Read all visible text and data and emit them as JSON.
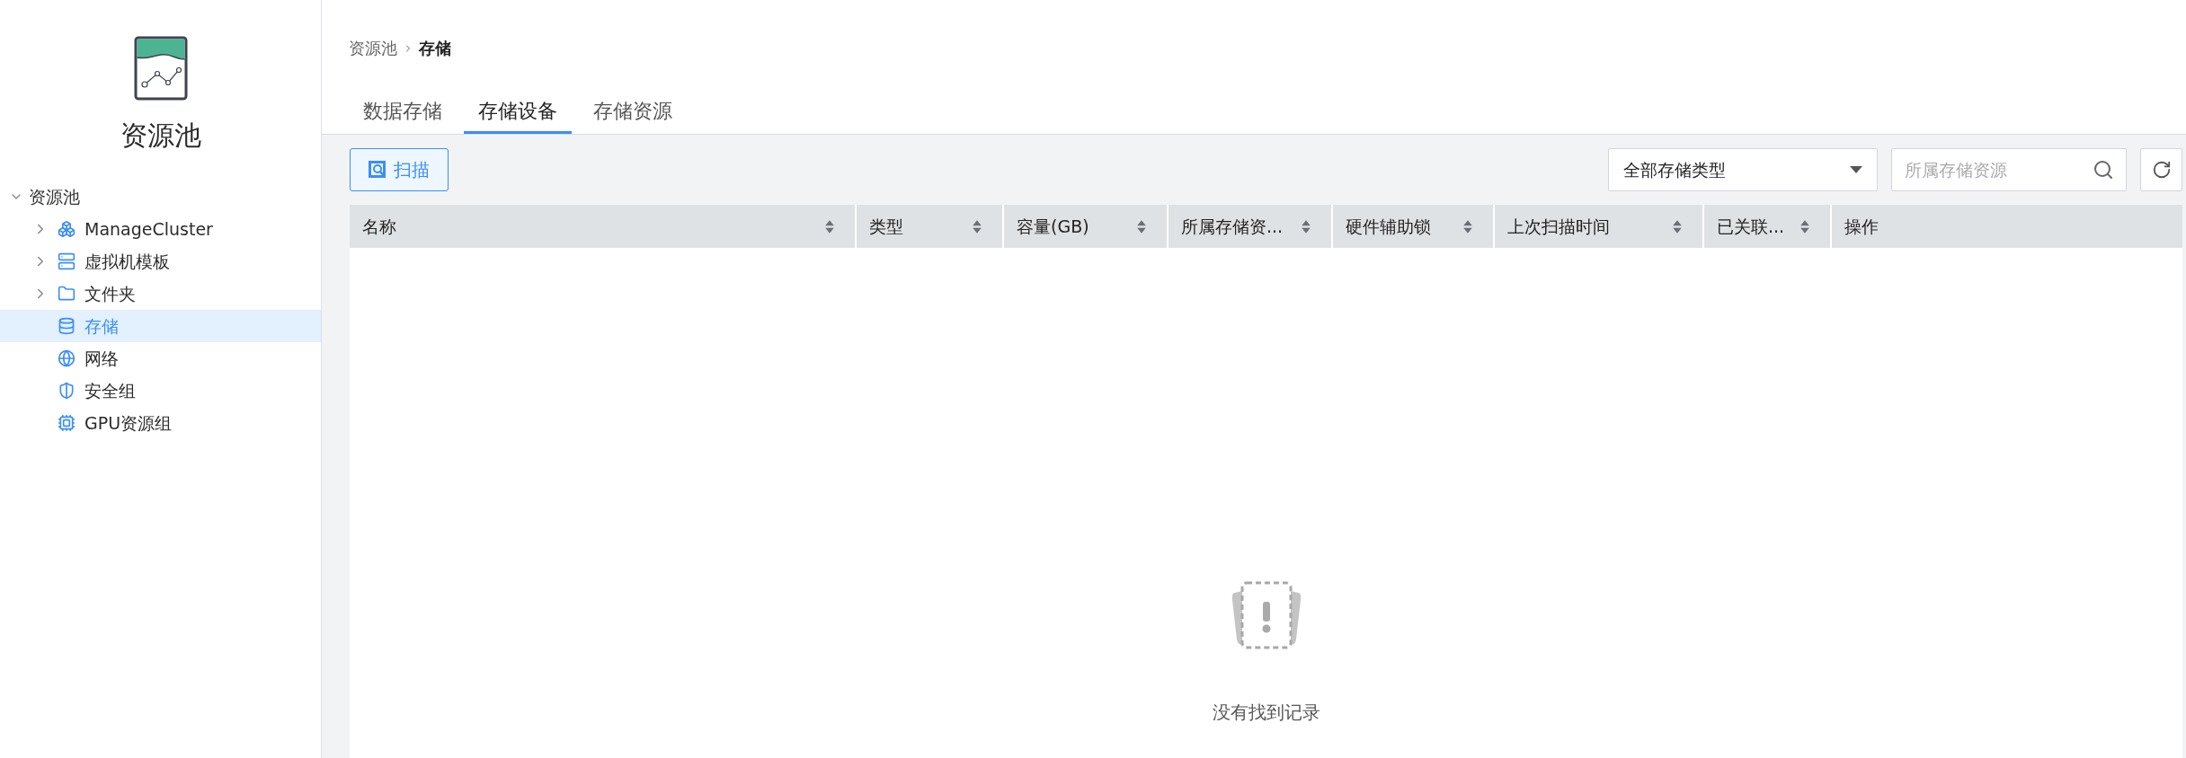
{
  "sidebar": {
    "title": "资源池",
    "tree": {
      "label": "资源池",
      "expanded": true,
      "children": [
        {
          "label": "ManageCluster",
          "kind": "cluster",
          "expandable": true,
          "selected": false
        },
        {
          "label": "虚拟机模板",
          "kind": "template",
          "expandable": true,
          "selected": false
        },
        {
          "label": "文件夹",
          "kind": "folder",
          "expandable": true,
          "selected": false
        },
        {
          "label": "存储",
          "kind": "storage",
          "expandable": false,
          "selected": true
        },
        {
          "label": "网络",
          "kind": "network",
          "expandable": false,
          "selected": false
        },
        {
          "label": "安全组",
          "kind": "security",
          "expandable": false,
          "selected": false
        },
        {
          "label": "GPU资源组",
          "kind": "gpu",
          "expandable": false,
          "selected": false
        }
      ]
    }
  },
  "breadcrumb": [
    "资源池",
    "存储"
  ],
  "tabs": [
    {
      "label": "数据存储",
      "selected": false
    },
    {
      "label": "存储设备",
      "selected": true
    },
    {
      "label": "存储资源",
      "selected": false
    }
  ],
  "toolbar": {
    "scan_button": "扫描",
    "type_select": "全部存储类型",
    "search": {
      "placeholder": "所属存储资源"
    }
  },
  "table": {
    "columns": [
      {
        "label": "名称",
        "sortable": true
      },
      {
        "label": "类型",
        "sortable": true
      },
      {
        "label": "容量(GB)",
        "sortable": true
      },
      {
        "label": "所属存储资...",
        "sortable": true
      },
      {
        "label": "硬件辅助锁",
        "sortable": true
      },
      {
        "label": "上次扫描时间",
        "sortable": true
      },
      {
        "label": "已关联...",
        "sortable": true
      },
      {
        "label": "操作",
        "sortable": false
      }
    ],
    "empty_message": "没有找到记录"
  }
}
